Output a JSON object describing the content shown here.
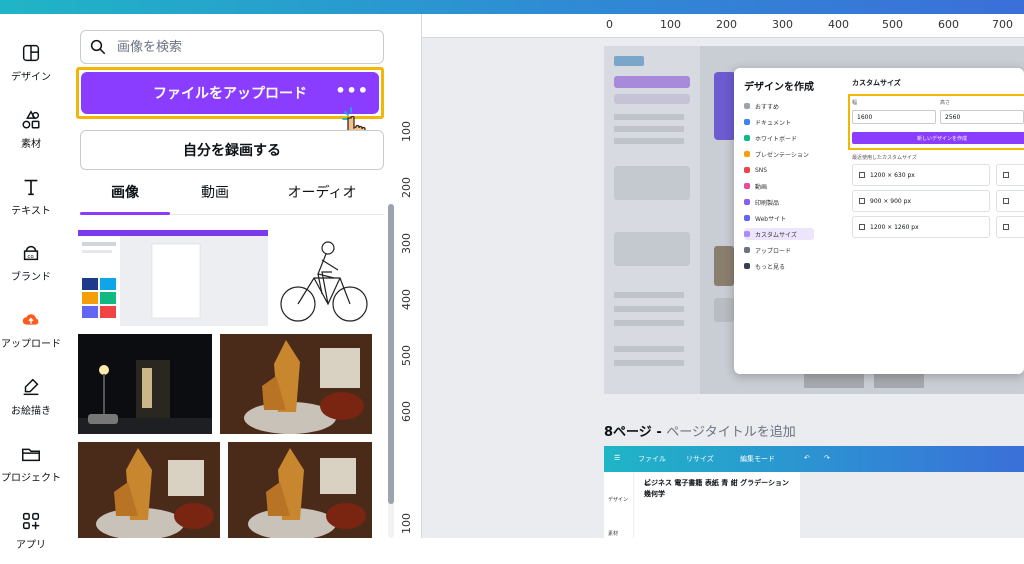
{
  "rail": {
    "items": [
      {
        "label": "デザイン",
        "icon": "layout-icon"
      },
      {
        "label": "素材",
        "icon": "shapes-icon"
      },
      {
        "label": "テキスト",
        "icon": "text-icon"
      },
      {
        "label": "ブランド",
        "icon": "brand-icon"
      },
      {
        "label": "アップロード",
        "icon": "upload-cloud-icon"
      },
      {
        "label": "お絵描き",
        "icon": "draw-icon"
      },
      {
        "label": "プロジェクト",
        "icon": "folder-icon"
      },
      {
        "label": "アプリ",
        "icon": "apps-icon"
      }
    ]
  },
  "panel": {
    "search_placeholder": "画像を検索",
    "upload_label": "ファイルをアップロード",
    "upload_more": "•••",
    "record_label": "自分を録画する",
    "tabs": [
      {
        "label": "画像",
        "active": true
      },
      {
        "label": "動画",
        "active": false
      },
      {
        "label": "オーディオ",
        "active": false
      }
    ]
  },
  "ruler": {
    "top": [
      "0",
      "100",
      "200",
      "300",
      "400",
      "500",
      "600",
      "700"
    ],
    "left": [
      "100",
      "200",
      "300",
      "400",
      "500",
      "600",
      "100"
    ]
  },
  "dialog": {
    "title": "デザインを作成",
    "menu": [
      "おすすめ",
      "ドキュメント",
      "ホワイトボード",
      "プレゼンテーション",
      "SNS",
      "動画",
      "印刷製品",
      "Webサイト",
      "カスタムサイズ",
      "アップロード",
      "もっと見る"
    ],
    "custom_title": "カスタムサイズ",
    "width_label": "幅",
    "height_label": "高さ",
    "width_value": "1600",
    "height_value": "2560",
    "create_label": "新しいデザインを作成",
    "recent_label": "最近使用したカスタムサイズ",
    "sizes": [
      "1200 × 630 px",
      "900 × 900 px",
      "1200 × 1260 px"
    ]
  },
  "page_section": {
    "number": "8ページ",
    "separator": " - ",
    "title": "ページタイトルを追加"
  },
  "page2": {
    "menu": [
      "ファイル",
      "リサイズ",
      "編集モード"
    ],
    "rail": [
      "デザイン",
      "素材"
    ],
    "heading": "ビジネス 電子書籍 表紙 青 紺 グラデーション　幾何学"
  },
  "colors": {
    "accent": "#8b3dff",
    "highlight": "#f2b705",
    "topbar_start": "#1fb5c6",
    "topbar_end": "#3b6fd9"
  }
}
